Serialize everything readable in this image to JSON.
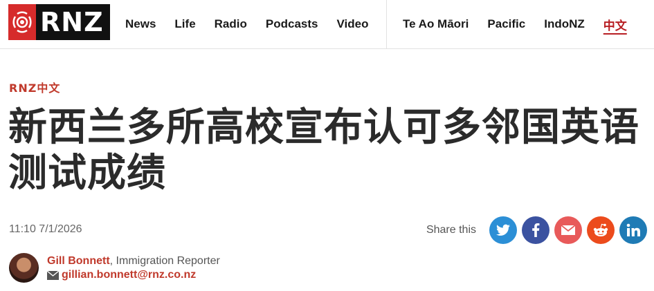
{
  "brand": {
    "logo_text": "RNZ"
  },
  "nav": {
    "main": [
      {
        "label": "News"
      },
      {
        "label": "Life"
      },
      {
        "label": "Radio"
      },
      {
        "label": "Podcasts"
      },
      {
        "label": "Video"
      }
    ],
    "secondary": [
      {
        "label": "Te Ao Māori"
      },
      {
        "label": "Pacific"
      },
      {
        "label": "IndoNZ"
      },
      {
        "label": "中文",
        "active": true
      }
    ]
  },
  "article": {
    "kicker": "RNZ中文",
    "headline": "新西兰多所高校宣布认可多邻国英语测试成绩",
    "timestamp": "11:10 7/1/2026",
    "share_label": "Share this",
    "share_buttons": [
      {
        "icon": "twitter-icon",
        "color": "#2c8fd6"
      },
      {
        "icon": "facebook-icon",
        "color": "#3b52a0"
      },
      {
        "icon": "email-icon",
        "color": "#e85a5a"
      },
      {
        "icon": "reddit-icon",
        "color": "#ec4b1c"
      },
      {
        "icon": "linkedin-icon",
        "color": "#1f7bb5"
      }
    ],
    "author": {
      "name": "Gill Bonnett",
      "role": ", Immigration Reporter",
      "email": "gillian.bonnett@rnz.co.nz"
    }
  },
  "colors": {
    "accent": "#c0392b",
    "logo_red": "#d62b2b"
  }
}
